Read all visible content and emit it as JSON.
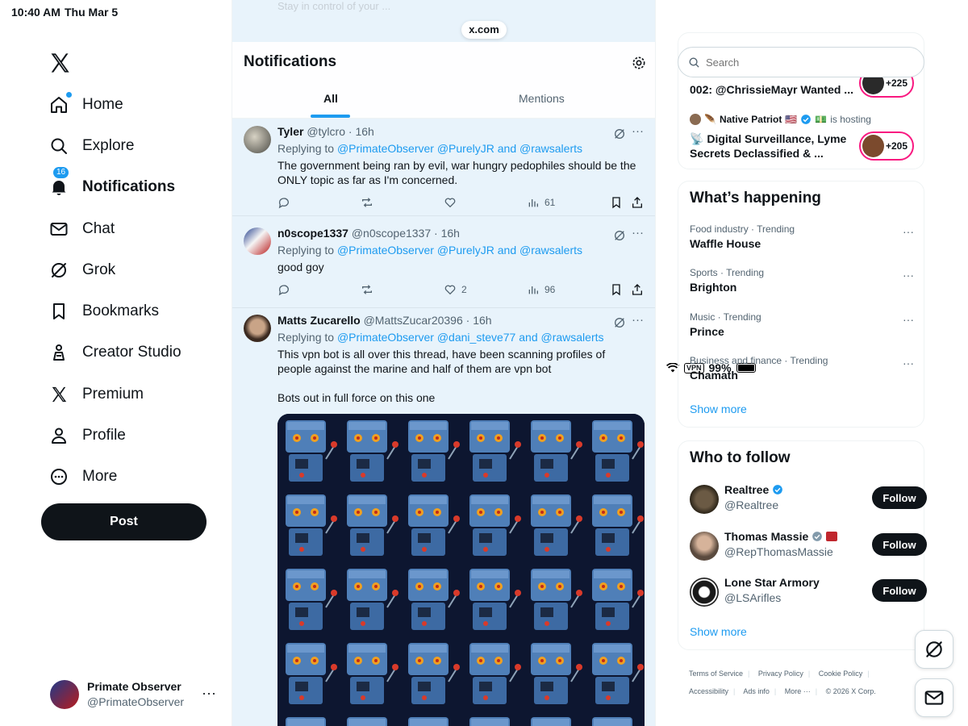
{
  "status_bar": {
    "time": "10:40 AM",
    "date": "Thu Mar 5",
    "vpn": "VPN",
    "battery": "99%"
  },
  "browser": {
    "url": "x.com"
  },
  "sidebar": {
    "items": [
      {
        "label": "Home",
        "icon": "home-icon"
      },
      {
        "label": "Explore",
        "icon": "search-icon"
      },
      {
        "label": "Notifications",
        "icon": "bell-icon",
        "badge": "16"
      },
      {
        "label": "Chat",
        "icon": "mail-icon"
      },
      {
        "label": "Grok",
        "icon": "grok-icon"
      },
      {
        "label": "Bookmarks",
        "icon": "bookmark-icon"
      },
      {
        "label": "Creator Studio",
        "icon": "creator-icon"
      },
      {
        "label": "Premium",
        "icon": "x-logo-icon"
      },
      {
        "label": "Profile",
        "icon": "person-icon"
      },
      {
        "label": "More",
        "icon": "more-circle-icon"
      }
    ],
    "post_label": "Post",
    "account": {
      "name": "Primate Observer",
      "handle": "@PrimateObserver",
      "more": "···"
    }
  },
  "main": {
    "ghost_text": "Stay in control of your ...",
    "title": "Notifications",
    "tabs": [
      {
        "label": "All"
      },
      {
        "label": "Mentions"
      }
    ],
    "tweets": [
      {
        "name": "Tyler",
        "handle": "@tylcro",
        "time": "16h",
        "replying": "Replying to",
        "mentions": "@PrimateObserver @PurelyJR",
        "and": "and",
        "last_mention": "@rawsalerts",
        "text": "The government being ran by evil, war hungry pedophiles should be the ONLY topic as far as I'm concerned.",
        "likes": "",
        "views": "61"
      },
      {
        "name": "n0scope1337",
        "handle": "@n0scope1337",
        "time": "16h",
        "replying": "Replying to",
        "mentions": "@PrimateObserver @PurelyJR",
        "and": "and",
        "last_mention": "@rawsalerts",
        "text": "good goy",
        "likes": "2",
        "views": "96"
      },
      {
        "name": "Matts Zucarello",
        "handle": "@MattsZucar20396",
        "time": "16h",
        "replying": "Replying to",
        "mentions": "@PrimateObserver @dani_steve77",
        "and": "and",
        "last_mention": "@rawsalerts",
        "text": "This vpn bot is all over this thread, have been scanning profiles of people against the marine and half of them are vpn bot\n\nBots out in full force on this one"
      }
    ]
  },
  "right": {
    "search_placeholder": "Search",
    "spaces": {
      "title_fragment": "002: @ChrissieMayr Wanted ...",
      "listeners_1": "+225",
      "host_name": "Native Patriot",
      "hosting_text": "is hosting",
      "space_title": "Digital Surveillance, Lyme Secrets Declassified & ...",
      "listeners_2": "+205"
    },
    "happening": {
      "title": "What’s happening",
      "trends": [
        {
          "meta": "Food industry · Trending",
          "name": "Waffle House"
        },
        {
          "meta": "Sports · Trending",
          "name": "Brighton"
        },
        {
          "meta": "Music · Trending",
          "name": "Prince"
        },
        {
          "meta": "Business and finance · Trending",
          "name": "Chamath"
        }
      ],
      "show_more": "Show more"
    },
    "who_to_follow": {
      "title": "Who to follow",
      "accounts": [
        {
          "name": "Realtree",
          "handle": "@Realtree",
          "follow": "Follow"
        },
        {
          "name": "Thomas Massie",
          "handle": "@RepThomasMassie",
          "follow": "Follow"
        },
        {
          "name": "Lone Star Armory",
          "handle": "@LSArifles",
          "follow": "Follow"
        }
      ],
      "show_more": "Show more"
    },
    "footer": {
      "links": [
        "Terms of Service",
        "Privacy Policy",
        "Cookie Policy",
        "Accessibility",
        "Ads info",
        "More ···"
      ],
      "copyright": "© 2026 X Corp."
    }
  },
  "colors": {
    "accent": "#1d9bf0",
    "text": "#0f1419",
    "muted": "#536471",
    "live": "#f91880"
  }
}
